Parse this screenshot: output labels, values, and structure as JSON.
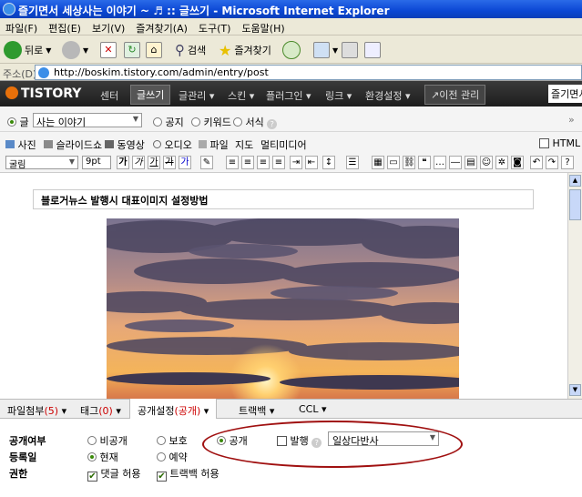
{
  "window": {
    "title": "즐기면서 세상사는 이야기 ~ ♬ :: 글쓰기 - Microsoft Internet Explorer"
  },
  "menu": [
    "파일(F)",
    "편집(E)",
    "보기(V)",
    "즐겨찾기(A)",
    "도구(T)",
    "도움말(H)"
  ],
  "toolbar": {
    "back": "뒤로",
    "search": "검색",
    "favorites": "즐겨찾기"
  },
  "address": {
    "label": "주소(D)",
    "url": "http://boskim.tistory.com/admin/entry/post"
  },
  "tistory": {
    "logo": "TISTORY",
    "nav": [
      "센터",
      "글쓰기",
      "글관리",
      "스킨",
      "플러그인",
      "링크",
      "환경설정"
    ],
    "prev": "↗이전 관리",
    "fav": "즐기면서"
  },
  "category": {
    "type_label": "글",
    "selected": "사는 이야기",
    "notice": "공지",
    "keyword": "키워드",
    "format": "서식"
  },
  "media": [
    "사진",
    "슬라이드쇼",
    "동영상",
    "오디오",
    "파일",
    "지도",
    "멀티미디어"
  ],
  "html_label": "HTML",
  "format": {
    "font": "굴림",
    "size": "9pt",
    "bold": "가",
    "italic": "가",
    "underline": "가",
    "strike": "가",
    "color": "가"
  },
  "post": {
    "title": "블로거뉴스 발행시 대표이미지 설정방법"
  },
  "tabs": {
    "attach": "파일첨부",
    "attach_count": "(5)",
    "tag": "태그",
    "tag_count": "(0)",
    "public": "공개설정",
    "public_state": "(공개)",
    "trackback": "트랙백",
    "ccl": "CCL"
  },
  "settings": {
    "visibility_label": "공개여부",
    "private": "비공개",
    "protected": "보호",
    "public": "공개",
    "publish": "발행",
    "category": "일상다반사",
    "register_label": "등록일",
    "now": "현재",
    "reserve": "예약",
    "perm_label": "권한",
    "allow_comment": "댓글 허용",
    "allow_trackback": "트랙백 허용"
  },
  "colors": {
    "accent": "#0b47d4",
    "highlight_ellipse": "#a01010",
    "red_text": "#cc0000"
  }
}
